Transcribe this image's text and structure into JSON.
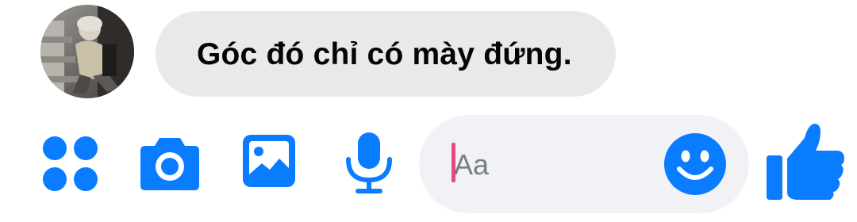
{
  "message": {
    "text": "Góc đó chỉ có mày đứng.",
    "sender_avatar_icon": "avatar-photo"
  },
  "composer": {
    "placeholder": "Aa",
    "icons": {
      "apps": "apps-grid-icon",
      "camera": "camera-icon",
      "gallery": "image-gallery-icon",
      "mic": "microphone-icon",
      "emoji": "emoji-smile-icon",
      "like": "thumbs-up-icon"
    }
  },
  "colors": {
    "accent": "#0a7cff",
    "bubble": "#e9e9eb",
    "composer_bg": "#f0f2f5",
    "caret": "#e84a7d"
  }
}
